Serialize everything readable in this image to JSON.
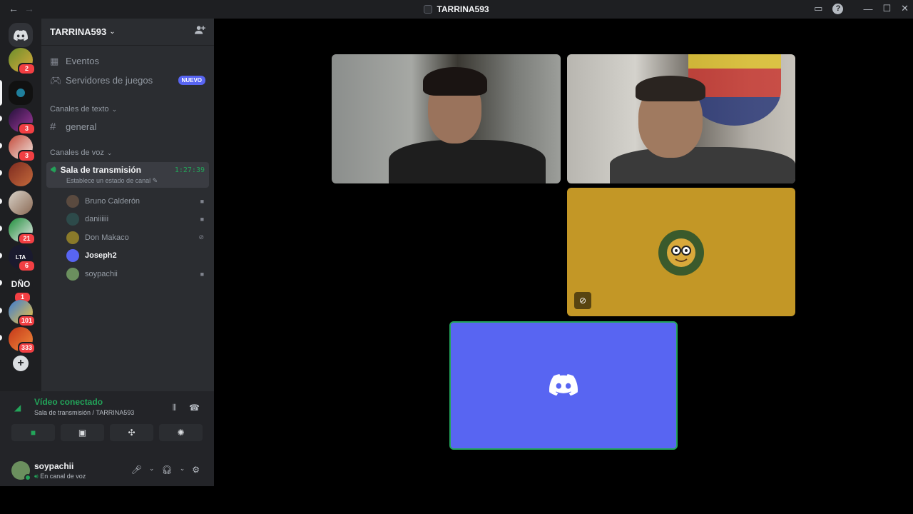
{
  "window": {
    "title": "TARRINA593"
  },
  "server": {
    "name": "TARRINA593"
  },
  "rail": {
    "badges": [
      "2",
      "3",
      "3",
      "21",
      "6",
      "1",
      "101",
      "333"
    ],
    "text_item": "DÑO"
  },
  "nav": {
    "events": "Eventos",
    "game_servers": "Servidores de juegos",
    "new_badge": "NUEVO"
  },
  "text_channels": {
    "category": "Canales de texto",
    "channels": [
      "general"
    ]
  },
  "voice_channels": {
    "category": "Canales de voz",
    "channel": {
      "name": "Sala de transmisión",
      "timer": "1:27:39",
      "status_placeholder": "Establece un estado de canal"
    },
    "members": [
      "Bruno Calderón",
      "daniiiiii",
      "Don Makaco",
      "Joseph2",
      "soypachii"
    ]
  },
  "voice_panel": {
    "status": "Vídeo conectado",
    "location": "Sala de transmisión / TARRINA593"
  },
  "user": {
    "name": "soypachii",
    "status": "En canal de voz"
  },
  "colors": {
    "accent": "#5865f2",
    "online": "#23a55a",
    "danger": "#f23f43",
    "tile_yellow": "#c39726"
  }
}
